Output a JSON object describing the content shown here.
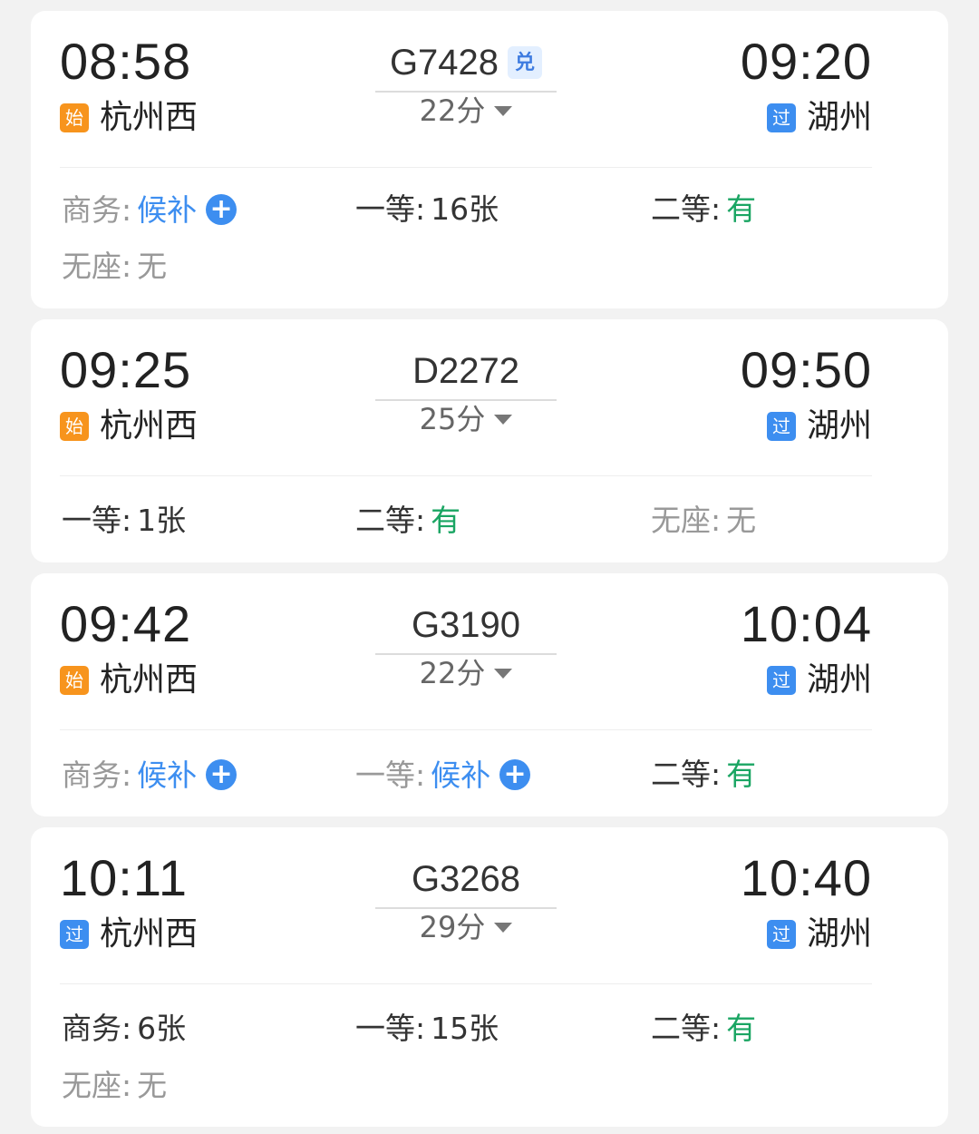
{
  "tags": {
    "origin": "始",
    "pass": "过",
    "redeem": "兑"
  },
  "trains": [
    {
      "dep_time": "08:58",
      "dep_station": "杭州西",
      "dep_tag": "始",
      "train_no": "G7428",
      "duration": "22分",
      "arr_time": "09:20",
      "arr_station": "湖州",
      "arr_tag": "过",
      "seats": [
        {
          "name": "商务",
          "value": "候补"
        },
        {
          "name": "一等",
          "value": "16张"
        },
        {
          "name": "二等",
          "value": "有"
        },
        {
          "name": "无座",
          "value": "无"
        }
      ]
    },
    {
      "dep_time": "09:25",
      "dep_station": "杭州西",
      "dep_tag": "始",
      "train_no": "D2272",
      "duration": "25分",
      "arr_time": "09:50",
      "arr_station": "湖州",
      "arr_tag": "过",
      "seats": [
        {
          "name": "一等",
          "value": "1张"
        },
        {
          "name": "二等",
          "value": "有"
        },
        {
          "name": "无座",
          "value": "无"
        }
      ]
    },
    {
      "dep_time": "09:42",
      "dep_station": "杭州西",
      "dep_tag": "始",
      "train_no": "G3190",
      "duration": "22分",
      "arr_time": "10:04",
      "arr_station": "湖州",
      "arr_tag": "过",
      "seats": [
        {
          "name": "商务",
          "value": "候补"
        },
        {
          "name": "一等",
          "value": "候补"
        },
        {
          "name": "二等",
          "value": "有"
        }
      ]
    },
    {
      "dep_time": "10:11",
      "dep_station": "杭州西",
      "dep_tag": "过",
      "train_no": "G3268",
      "duration": "29分",
      "arr_time": "10:40",
      "arr_station": "湖州",
      "arr_tag": "过",
      "seats": [
        {
          "name": "商务",
          "value": "6张"
        },
        {
          "name": "一等",
          "value": "15张"
        },
        {
          "name": "二等",
          "value": "有"
        },
        {
          "name": "无座",
          "value": "无"
        }
      ]
    }
  ],
  "colors": {
    "origin_tag": "#f7941d",
    "pass_tag": "#3d8ef0",
    "available": "#1aa563",
    "waitlist": "#3d8ef0",
    "muted": "#999999"
  }
}
